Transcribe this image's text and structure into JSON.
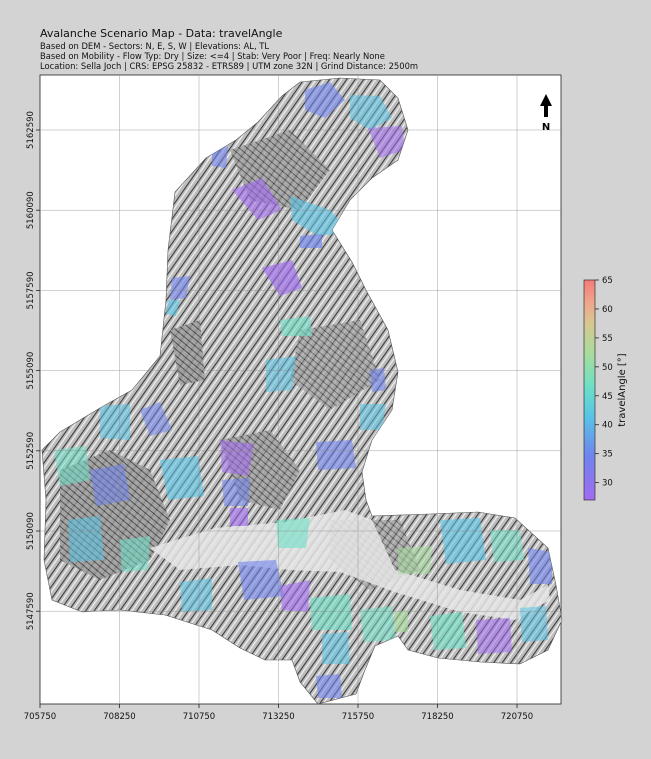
{
  "title": "Avalanche Scenario Map - Data: travelAngle",
  "subtitle_lines": [
    "Based on DEM - Sectors: N, E, S, W |  Elevations: AL, TL",
    "Based on Mobility - Flow Typ: Dry |  Size: <=4 |  Stab: Very Poor |  Freq: Nearly None",
    "Location: Sella Joch | CRS: EPSG 25832 - ETRS89 | UTM zone 32N | Grind Distance: 2500m"
  ],
  "north_arrow_label": "N",
  "x_ticks": [
    "705750",
    "708250",
    "710750",
    "713250",
    "715750",
    "718250",
    "720750"
  ],
  "y_ticks": [
    "5162590",
    "5160090",
    "5157590",
    "5155090",
    "5152590",
    "5150090",
    "5147590"
  ],
  "colorbar": {
    "label": "travelAngle [°]",
    "min": 27,
    "max": 65,
    "ticks": [
      "30",
      "35",
      "40",
      "45",
      "50",
      "55",
      "60",
      "65"
    ],
    "colors": [
      "#a26bf2",
      "#6f84ee",
      "#58c4e6",
      "#6ee0c6",
      "#a6dc9c",
      "#d7c890",
      "#f0a58c",
      "#f67a78"
    ]
  }
}
